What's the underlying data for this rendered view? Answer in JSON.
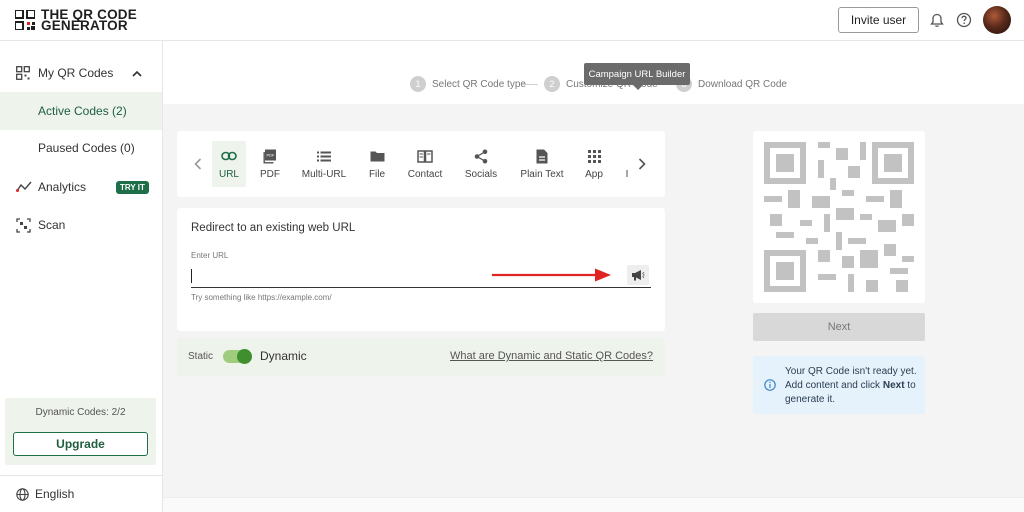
{
  "header": {
    "logo_line1": "THE QR CODE",
    "logo_line2": "GENERATOR",
    "invite_label": "Invite user",
    "icons": [
      "bell-icon",
      "help-icon"
    ]
  },
  "sidebar": {
    "my_qr_codes": "My QR Codes",
    "active_codes": "Active Codes (2)",
    "paused_codes": "Paused Codes (0)",
    "analytics": "Analytics",
    "try_badge": "TRY IT",
    "scan": "Scan",
    "dynamic_codes": "Dynamic Codes: 2/2",
    "upgrade": "Upgrade",
    "language": "English"
  },
  "stepper": {
    "steps": [
      {
        "num": "1",
        "label": "Select QR Code type"
      },
      {
        "num": "2",
        "label": "Customize QR Code"
      },
      {
        "num": "3",
        "label": "Download QR Code"
      }
    ]
  },
  "types": {
    "items": [
      "URL",
      "PDF",
      "Multi-URL",
      "File",
      "Contact",
      "Socials",
      "Plain Text",
      "App",
      "I"
    ],
    "active": "URL"
  },
  "url_form": {
    "title": "Redirect to an existing web URL",
    "label": "Enter URL",
    "value": "",
    "hint": "Try something like https://example.com/",
    "tooltip": "Campaign URL Builder"
  },
  "toggle": {
    "static": "Static",
    "dynamic": "Dynamic",
    "link": "What are Dynamic and Static QR Codes?"
  },
  "preview": {
    "next": "Next",
    "info_line1": "Your QR Code isn't ready yet.",
    "info_line2_pre": "Add content and click ",
    "info_line2_bold": "Next",
    "info_line2_post": " to",
    "info_line3": "generate it."
  },
  "colors": {
    "brand_green": "#1f6e4a",
    "active_bg": "#eef3ec",
    "accent_red": "#e02424",
    "info_bg": "#e5f1fb"
  }
}
